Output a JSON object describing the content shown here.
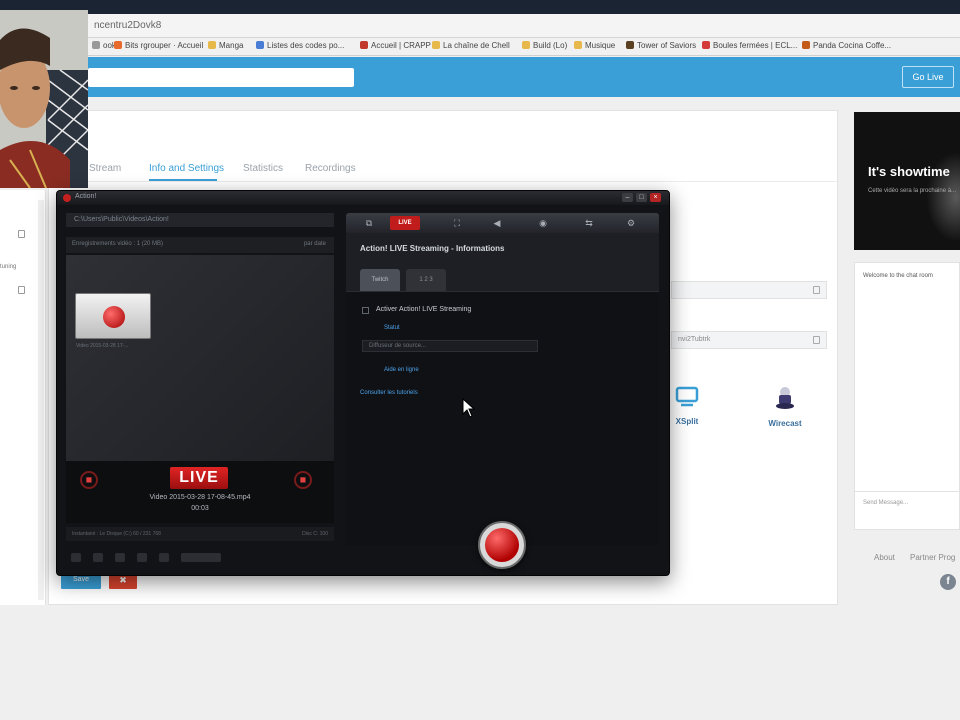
{
  "browser": {
    "url": "ncentru2Dovk8",
    "bookmarks": [
      {
        "label": "ook",
        "color": "#999999"
      },
      {
        "label": "Bits rgrouper · Accueil",
        "color": "#e8692c"
      },
      {
        "label": "Manga",
        "color": "#e7b84a"
      },
      {
        "label": "Listes des codes po...",
        "color": "#4a7ed6"
      },
      {
        "label": "Accueil | CRAPP",
        "color": "#c0392b"
      },
      {
        "label": "La chaîne de Chell",
        "color": "#e7b84a"
      },
      {
        "label": "Build (Lo)",
        "color": "#e7b84a"
      },
      {
        "label": "Musique",
        "color": "#e7b84a"
      },
      {
        "label": "Tower of Saviors",
        "color": "#5a4020"
      },
      {
        "label": "Boules fermées | ECL...",
        "color": "#d43a3a"
      },
      {
        "label": "Panda Cocina Coffe...",
        "color": "#c45a18"
      }
    ]
  },
  "site": {
    "go_live_label": "Go Live",
    "tabs": [
      "Stream",
      "Info and Settings",
      "Statistics",
      "Recordings"
    ],
    "field_2_text": "nvi2Tubtrk",
    "apps": [
      {
        "name": "XSplit",
        "icon": "xsplit-icon"
      },
      {
        "name": "Wirecast",
        "icon": "wirecast-icon"
      }
    ],
    "left_label": "tuning",
    "save_label": "Save",
    "delete_label": "✖"
  },
  "preview": {
    "title": "It's showtime",
    "subtitle": "Cette vidéo sera la prochaine à..."
  },
  "chat": {
    "welcome": "Welcome to the chat room",
    "input_placeholder": "Send Message..."
  },
  "footer": {
    "about": "About",
    "partner": "Partner Prog",
    "facebook_glyph": "f"
  },
  "recorder": {
    "title": "Action!",
    "path": "C:\\Users\\Public\\Videos\\Action!",
    "list_header": "Enregistrements vidéo : 1 (20 MB)",
    "list_sort": "par date",
    "thumb_label": "Video 2015-03-28 17-...",
    "live_badge": "LIVE",
    "live_file": "Video 2015-03-28 17-08-45.mp4",
    "live_time": "00:03",
    "status_left": "Instantané : Le Disque (C:) 60 / 231 768",
    "status_right": "Disc C: 100",
    "right_title": "Action! LIVE Streaming - Informations",
    "tab1": "Twitch",
    "tab2": "1 2 3",
    "checkbox_label": "Activer Action! LIVE Streaming",
    "link_detect": "Statut",
    "input_placeholder": "Diffuseur de source...",
    "link_help": "Aide en ligne",
    "link_tutorials": "Consulter les tutoriels",
    "toolbar_live": "LIVE"
  }
}
